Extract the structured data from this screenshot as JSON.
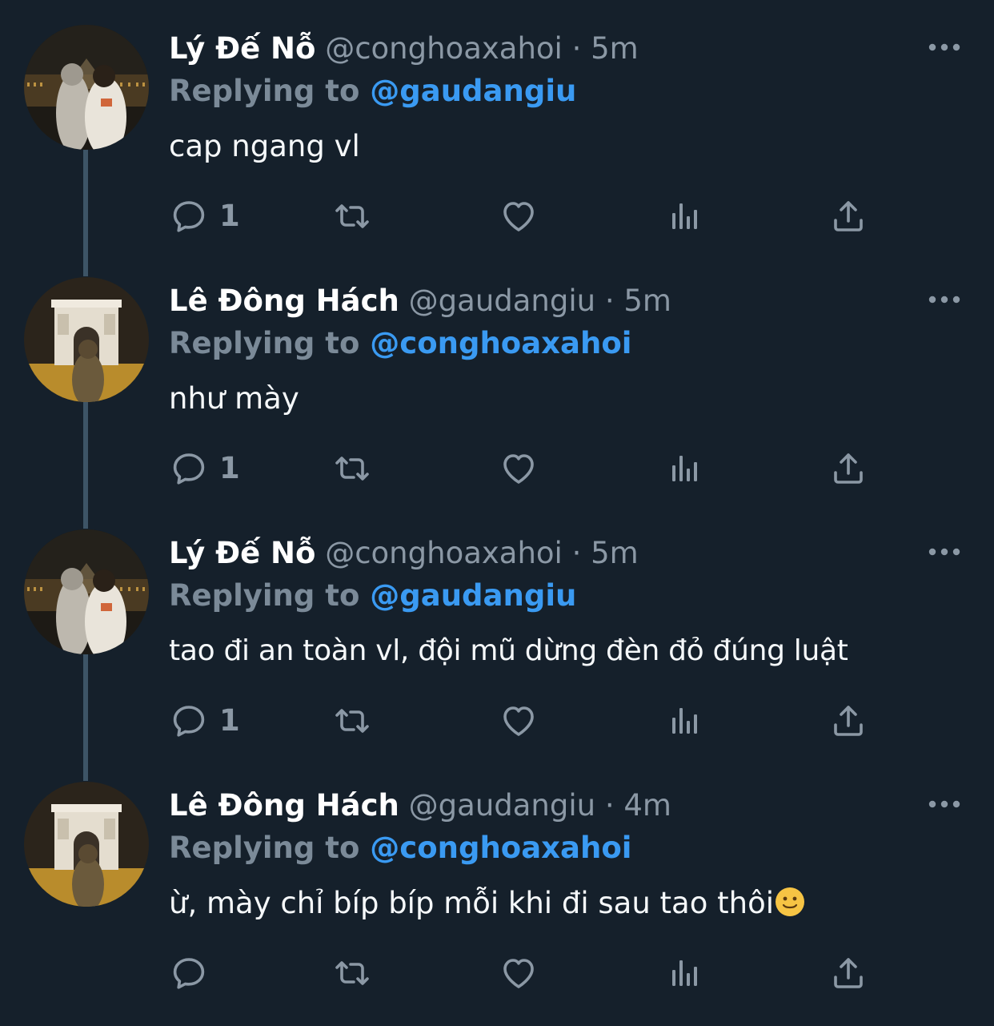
{
  "tweets": [
    {
      "display_name": "Lý Đế Nỗ",
      "handle": "@conghoaxahoi",
      "separator": "·",
      "time": "5m",
      "replying_label": "Replying to",
      "replying_to": "@gaudangiu",
      "text": "cap ngang vl",
      "emoji": "",
      "reply_count": "1",
      "avatar": "couple-at-louvre-night"
    },
    {
      "display_name": "Lê Đông Hách",
      "handle": "@gaudangiu",
      "separator": "·",
      "time": "5m",
      "replying_label": "Replying to",
      "replying_to": "@conghoaxahoi",
      "text": "như mày",
      "emoji": "",
      "reply_count": "1",
      "avatar": "person-at-arc-de-triomphe"
    },
    {
      "display_name": "Lý Đế Nỗ",
      "handle": "@conghoaxahoi",
      "separator": "·",
      "time": "5m",
      "replying_label": "Replying to",
      "replying_to": "@gaudangiu",
      "text": "tao đi an toàn vl, đội mũ dừng đèn đỏ đúng luật",
      "emoji": "",
      "reply_count": "1",
      "avatar": "couple-at-louvre-night"
    },
    {
      "display_name": "Lê Đông Hách",
      "handle": "@gaudangiu",
      "separator": "·",
      "time": "4m",
      "replying_label": "Replying to",
      "replying_to": "@conghoaxahoi",
      "text": "ừ, mày chỉ bíp bíp mỗi khi đi sau tao thôi",
      "emoji": "slightly-smiling-face",
      "reply_count": "",
      "avatar": "person-at-arc-de-triomphe"
    }
  ],
  "icons": {
    "reply": "reply-bubble-icon",
    "retweet": "retweet-icon",
    "like": "heart-icon",
    "stats": "analytics-icon",
    "share": "share-icon",
    "more": "more-dots-icon"
  },
  "colors": {
    "background": "#15202b",
    "name": "#ffffff",
    "meta": "#8b98a5",
    "mention": "#3a9af2",
    "thread_line": "#3d5466"
  }
}
